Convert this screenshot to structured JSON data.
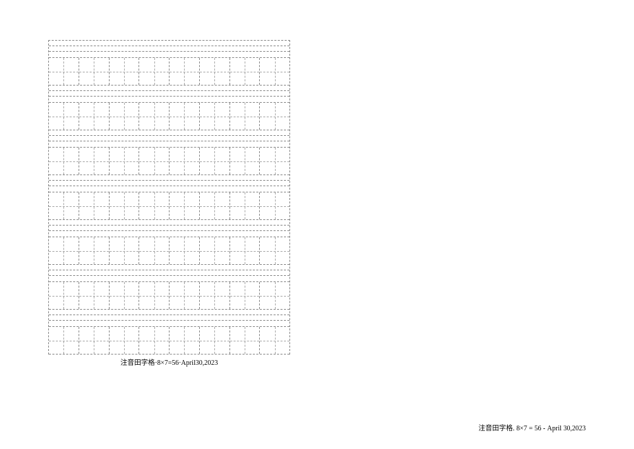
{
  "grid": {
    "cols": 8,
    "rows": 7,
    "total": 56,
    "pinyin_lines": 3
  },
  "caption_left": "注音田字格·8×7=56·April30,2023",
  "caption_right": "注音田字格.  8×7 = 56 - April 30,2023"
}
